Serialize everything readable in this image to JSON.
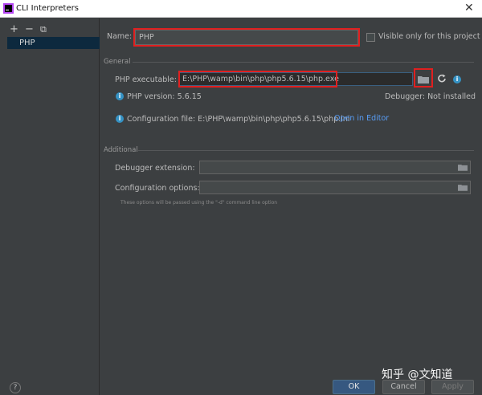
{
  "window": {
    "title": "CLI Interpreters",
    "close_glyph": "✕"
  },
  "left_panel": {
    "toolbar": {
      "add": "+",
      "remove": "−",
      "copy": "⧉"
    },
    "items": [
      {
        "label": "PHP"
      }
    ],
    "help": "?"
  },
  "form": {
    "name_label": "Name:",
    "name_value": "PHP",
    "visible_only_label": "Visible only for this project",
    "visible_only_checked": false,
    "general_section": "General",
    "php_exec_label": "PHP executable:",
    "php_exec_value": "E:\\PHP\\wamp\\bin\\php\\php5.6.15\\php.exe",
    "php_version_text": "PHP version: 5.6.15",
    "debugger_text": "Debugger: Not installed",
    "config_file_text": "Configuration file: E:\\PHP\\wamp\\bin\\php\\php5.6.15\\php.ini",
    "open_in_editor": "Open in Editor",
    "additional_section": "Additional",
    "debugger_ext_label": "Debugger extension:",
    "debugger_ext_value": "",
    "config_options_label": "Configuration options:",
    "config_options_value": "",
    "hint_text": "These options will be passed using the \"-d\" command line option"
  },
  "buttons": {
    "ok": "OK",
    "cancel": "Cancel",
    "apply": "Apply"
  },
  "watermark": "知乎 @文知道",
  "colors": {
    "highlight_red": "#e02020",
    "link": "#589df6",
    "info": "#3592c4",
    "primary_button": "#365880"
  }
}
